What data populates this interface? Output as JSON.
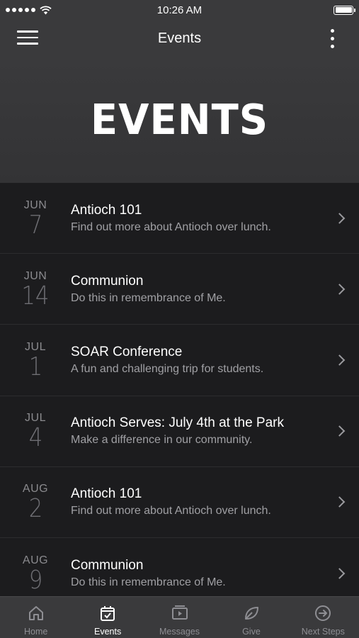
{
  "status_bar": {
    "time": "10:26 AM"
  },
  "nav": {
    "title": "Events"
  },
  "hero": {
    "title": "EVENTS"
  },
  "events": [
    {
      "month": "JUN",
      "day": "7",
      "title": "Antioch 101",
      "description": "Find out more about Antioch over lunch."
    },
    {
      "month": "JUN",
      "day": "14",
      "title": "Communion",
      "description": "Do this in remembrance of Me."
    },
    {
      "month": "JUL",
      "day": "1",
      "title": "SOAR Conference",
      "description": "A fun and challenging trip for students."
    },
    {
      "month": "JUL",
      "day": "4",
      "title": "Antioch Serves: July 4th at the Park",
      "description": "Make a difference in our community."
    },
    {
      "month": "AUG",
      "day": "2",
      "title": "Antioch 101",
      "description": "Find out more about Antioch over lunch."
    },
    {
      "month": "AUG",
      "day": "9",
      "title": "Communion",
      "description": "Do this in remembrance of Me."
    }
  ],
  "tabs": [
    {
      "label": "Home",
      "icon": "home-icon",
      "active": false
    },
    {
      "label": "Events",
      "icon": "calendar-icon",
      "active": true
    },
    {
      "label": "Messages",
      "icon": "video-icon",
      "active": false
    },
    {
      "label": "Give",
      "icon": "leaf-icon",
      "active": false
    },
    {
      "label": "Next Steps",
      "icon": "arrow-circle-icon",
      "active": false
    }
  ]
}
